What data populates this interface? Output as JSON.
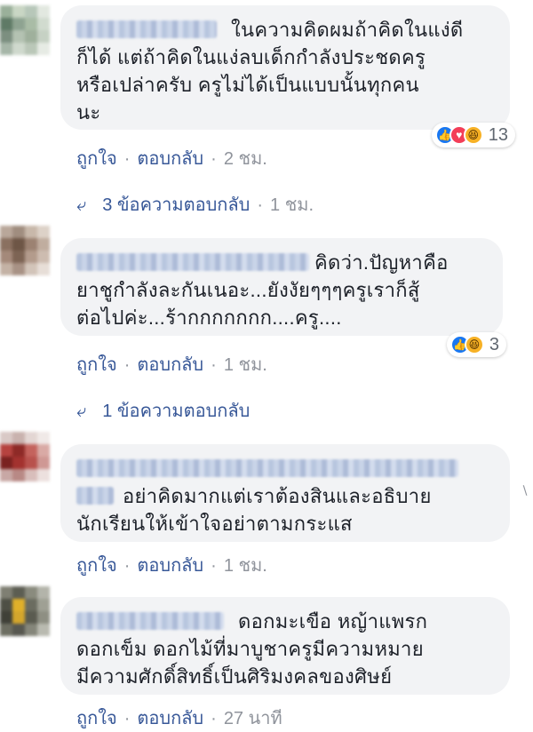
{
  "colors": {
    "bubble": "#f2f3f5",
    "link": "#385898",
    "meta": "#90949c",
    "like": "#1877f2",
    "love": "#f33e58",
    "haha": "#f7b125"
  },
  "comments": [
    {
      "lines": [
        "ในความคิดผมถ้าคิดในแง่ดี",
        "ก็ได้ แต่ถ้าคิดในแง่ลบเด็กกำลังประชดครู",
        "หรือเปล่าครับ ครูไม่ได้เป็นแบบนั้นทุกคน",
        "นะ"
      ],
      "reactions": {
        "icons": [
          "like-icon",
          "love-icon",
          "haha-icon"
        ],
        "count": "13"
      },
      "like_label": "ถูกใจ",
      "reply_label": "ตอบกลับ",
      "time": "2 ชม.",
      "replies": {
        "label": "3 ข้อความตอบกลับ",
        "time": "1 ชม."
      }
    },
    {
      "lines": [
        "คิดว่า.ปัญหาคือ",
        "ยาชูกำลังละกันเนอะ...ยังงัยๆๆๆครูเราก็สู้",
        "ต่อไปค่ะ...ร้ากกกกกกก....ครู...."
      ],
      "reactions": {
        "icons": [
          "like-icon",
          "haha-icon"
        ],
        "count": "3"
      },
      "like_label": "ถูกใจ",
      "reply_label": "ตอบกลับ",
      "time": "1 ชม.",
      "replies": {
        "label": "1 ข้อความตอบกลับ"
      }
    },
    {
      "lines": [
        "อย่าคิดมากแต่เราต้องสินและอธิบาย",
        "นักเรียนให้เข้าใจอย่าตามกระแส"
      ],
      "like_label": "ถูกใจ",
      "reply_label": "ตอบกลับ",
      "time": "1 ชม."
    },
    {
      "lines": [
        "ดอกมะเขือ หญ้าแพรก",
        "ดอกเข็ม ดอกไม้ที่มาบูชาครูมีความหมาย",
        "มีความศักดิ์สิทธิ์เป็นศิริมงคลของศิษย์"
      ],
      "like_label": "ถูกใจ",
      "reply_label": "ตอบกลับ",
      "time": "27 นาที"
    }
  ]
}
